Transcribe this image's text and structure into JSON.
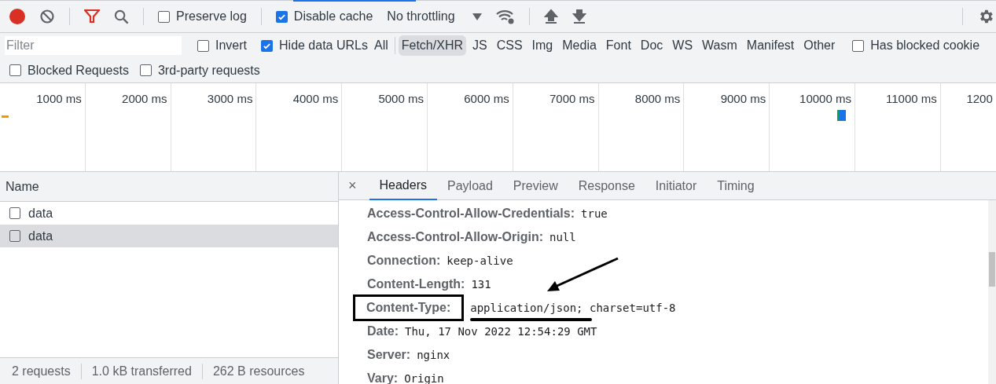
{
  "toolbar": {
    "preserve_log": {
      "label": "Preserve log",
      "checked": false
    },
    "disable_cache": {
      "label": "Disable cache",
      "checked": true
    },
    "throttling": "No throttling"
  },
  "filter_bar": {
    "placeholder": "Filter",
    "invert": {
      "label": "Invert",
      "checked": false
    },
    "hide_data_urls": {
      "label": "Hide data URLs",
      "checked": true
    },
    "types": [
      {
        "label": "All",
        "selected": false
      },
      {
        "label": "Fetch/XHR",
        "selected": true
      },
      {
        "label": "JS",
        "selected": false
      },
      {
        "label": "CSS",
        "selected": false
      },
      {
        "label": "Img",
        "selected": false
      },
      {
        "label": "Media",
        "selected": false
      },
      {
        "label": "Font",
        "selected": false
      },
      {
        "label": "Doc",
        "selected": false
      },
      {
        "label": "WS",
        "selected": false
      },
      {
        "label": "Wasm",
        "selected": false
      },
      {
        "label": "Manifest",
        "selected": false
      },
      {
        "label": "Other",
        "selected": false
      }
    ],
    "has_blocked_cookies": {
      "label": "Has blocked cookie",
      "checked": false
    },
    "blocked_requests": {
      "label": "Blocked Requests",
      "checked": false
    },
    "third_party": {
      "label": "3rd-party requests",
      "checked": false
    }
  },
  "timeline": {
    "ticks": [
      "1000 ms",
      "2000 ms",
      "3000 ms",
      "4000 ms",
      "5000 ms",
      "6000 ms",
      "7000 ms",
      "8000 ms",
      "9000 ms",
      "10000 ms",
      "11000 ms",
      "1200"
    ]
  },
  "requests": {
    "column": "Name",
    "rows": [
      {
        "name": "data",
        "selected": false
      },
      {
        "name": "data",
        "selected": true
      }
    ]
  },
  "details": {
    "close": "×",
    "tabs": [
      {
        "label": "Headers",
        "selected": true
      },
      {
        "label": "Payload",
        "selected": false
      },
      {
        "label": "Preview",
        "selected": false
      },
      {
        "label": "Response",
        "selected": false
      },
      {
        "label": "Initiator",
        "selected": false
      },
      {
        "label": "Timing",
        "selected": false
      }
    ],
    "headers": [
      {
        "name": "Access-Control-Allow-Credentials:",
        "value": "true",
        "annotated": false
      },
      {
        "name": "Access-Control-Allow-Origin:",
        "value": "null",
        "annotated": false
      },
      {
        "name": "Connection:",
        "value": "keep-alive",
        "annotated": false
      },
      {
        "name": "Content-Length:",
        "value": "131",
        "annotated": false
      },
      {
        "name": "Content-Type:",
        "value": "application/json; charset=utf-8",
        "annotated": true
      },
      {
        "name": "Date:",
        "value": "Thu, 17 Nov 2022 12:54:29 GMT",
        "annotated": false
      },
      {
        "name": "Server:",
        "value": "nginx",
        "annotated": false
      },
      {
        "name": "Vary:",
        "value": "Origin",
        "annotated": false
      }
    ]
  },
  "status_bar": [
    "2 requests",
    "1.0 kB transferred",
    "262 B resources"
  ]
}
